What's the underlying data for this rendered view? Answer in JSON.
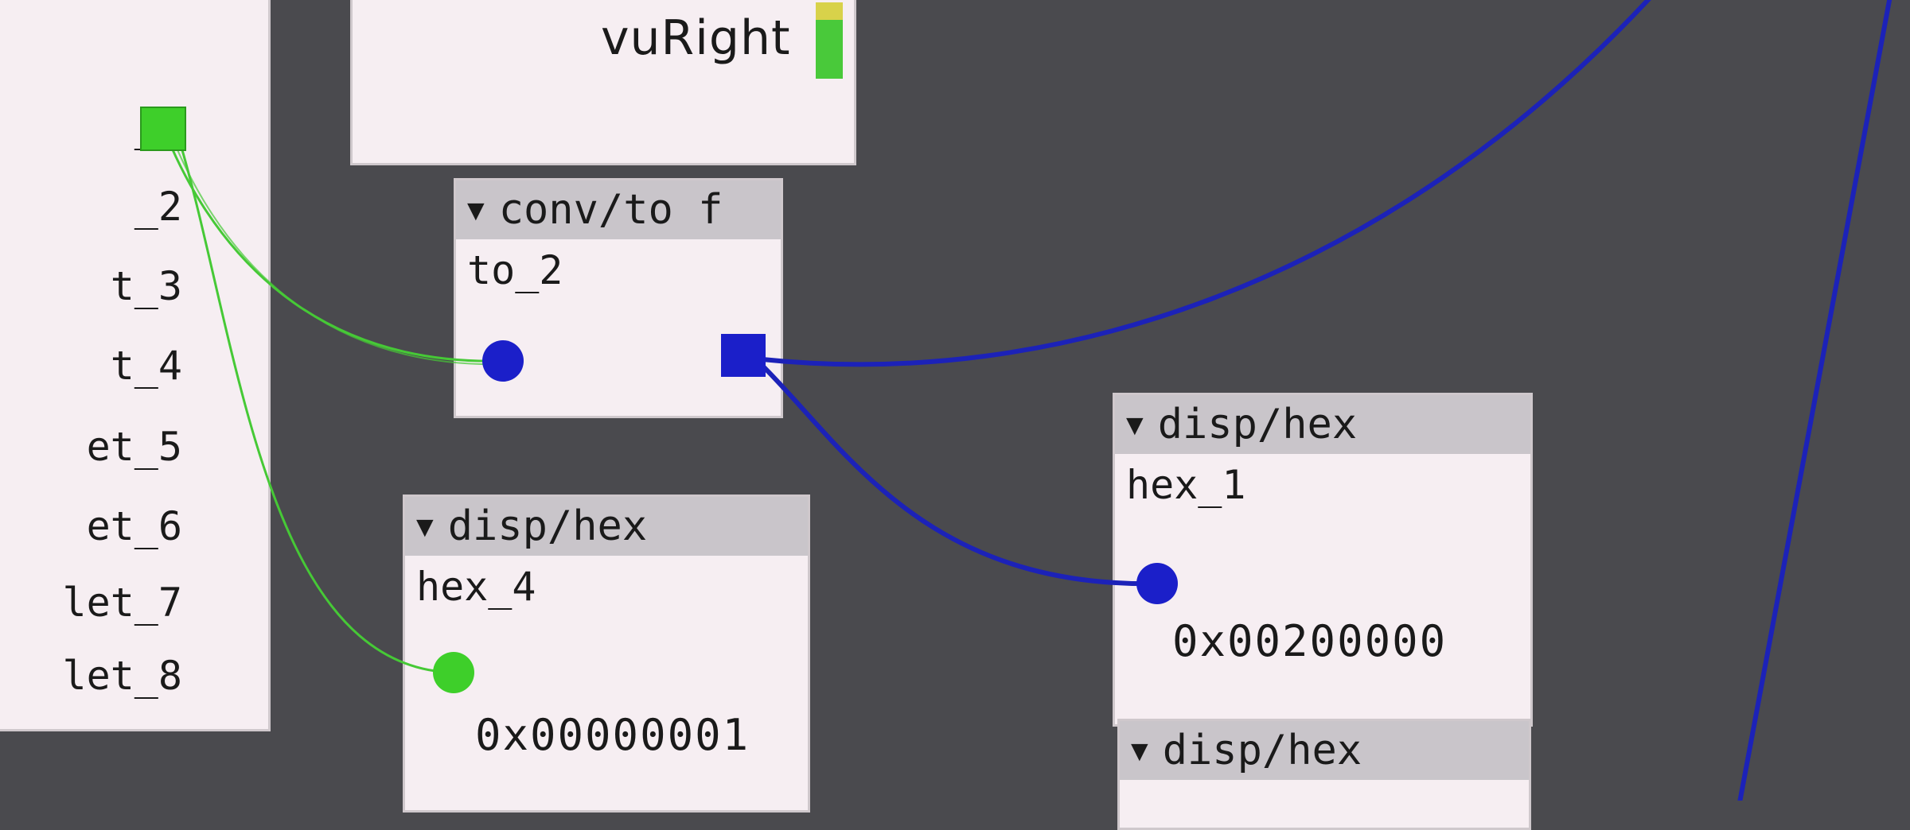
{
  "patch": {
    "left_object": {
      "outlets": [
        {
          "label": "_1",
          "port_color": "#3ecf2a"
        },
        {
          "label": "_2"
        },
        {
          "label": "t_3"
        },
        {
          "label": "t_4"
        },
        {
          "label": "et_5"
        },
        {
          "label": "et_6"
        },
        {
          "label": "let_7"
        },
        {
          "label": "let_8"
        }
      ]
    },
    "vu_object": {
      "label": "vuRight"
    },
    "conv_to_f": {
      "header": "conv/to f",
      "instance": "to_2",
      "inlet_color": "#1b1fc9",
      "outlet_color": "#1b1fc9"
    },
    "hex_4": {
      "header": "disp/hex",
      "instance": "hex_4",
      "value": "0x00000001",
      "inlet_color": "#3ecf2a"
    },
    "hex_1": {
      "header": "disp/hex",
      "instance": "hex_1",
      "value": "0x00200000",
      "inlet_color": "#1b1fc9"
    },
    "hex_bottom": {
      "header": "disp/hex"
    },
    "collapse_glyph": "▼",
    "wire_colors": {
      "bool": "#46c936",
      "frac": "#1c22b8"
    }
  }
}
